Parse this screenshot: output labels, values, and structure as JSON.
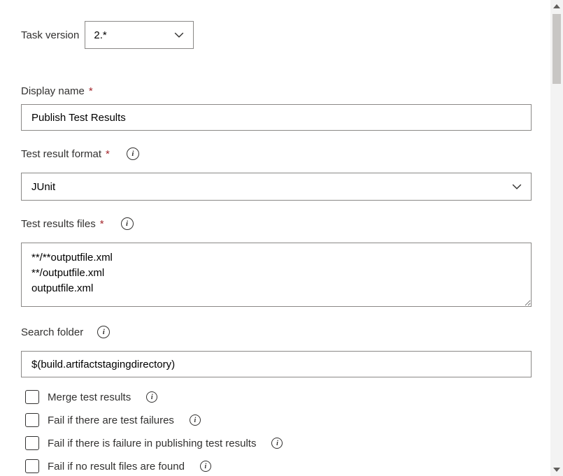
{
  "taskVersion": {
    "label": "Task version",
    "value": "2.*"
  },
  "displayName": {
    "label": "Display name",
    "value": "Publish Test Results"
  },
  "testResultFormat": {
    "label": "Test result format",
    "value": "JUnit"
  },
  "testResultsFiles": {
    "label": "Test results files",
    "value": "**/**outputfile.xml\n**/outputfile.xml\noutputfile.xml"
  },
  "searchFolder": {
    "label": "Search folder",
    "value": "$(build.artifactstagingdirectory)"
  },
  "checkboxes": {
    "merge": {
      "label": "Merge test results",
      "checked": false
    },
    "failOnFailures": {
      "label": "Fail if there are test failures",
      "checked": false
    },
    "failOnPublish": {
      "label": "Fail if there is failure in publishing test results",
      "checked": false
    },
    "failNoResults": {
      "label": "Fail if no result files are found",
      "checked": false
    }
  }
}
